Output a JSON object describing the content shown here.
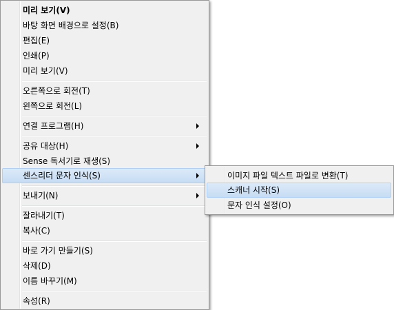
{
  "context_menu": {
    "items": [
      {
        "label": "미리 보기(V)"
      },
      {
        "label": "바탕 화면 배경으로 설정(B)"
      },
      {
        "label": "편집(E)"
      },
      {
        "label": "인쇄(P)"
      },
      {
        "label": "미리 보기(V)"
      },
      {
        "label": "오른쪽으로 회전(T)"
      },
      {
        "label": "왼쪽으로 회전(L)"
      },
      {
        "label": "연결 프로그램(H)"
      },
      {
        "label": "공유 대상(H)"
      },
      {
        "label": "Sense 독서기로 재생(S)"
      },
      {
        "label": "센스리더 문자 인식(S)"
      },
      {
        "label": "보내기(N)"
      },
      {
        "label": "잘라내기(T)"
      },
      {
        "label": "복사(C)"
      },
      {
        "label": "바로 가기 만들기(S)"
      },
      {
        "label": "삭제(D)"
      },
      {
        "label": "이름 바꾸기(M)"
      },
      {
        "label": "속성(R)"
      }
    ]
  },
  "submenu": {
    "items": [
      {
        "label": "이미지 파일 텍스트 파일로 변환(T)"
      },
      {
        "label": "스캐너 시작(S)"
      },
      {
        "label": "문자 인식 설정(O)"
      }
    ]
  },
  "colors": {
    "menu_background": "#f0f0f0",
    "menu_border": "#979797",
    "highlight": "#c6dcf3",
    "highlight_border": "#aecff7"
  }
}
